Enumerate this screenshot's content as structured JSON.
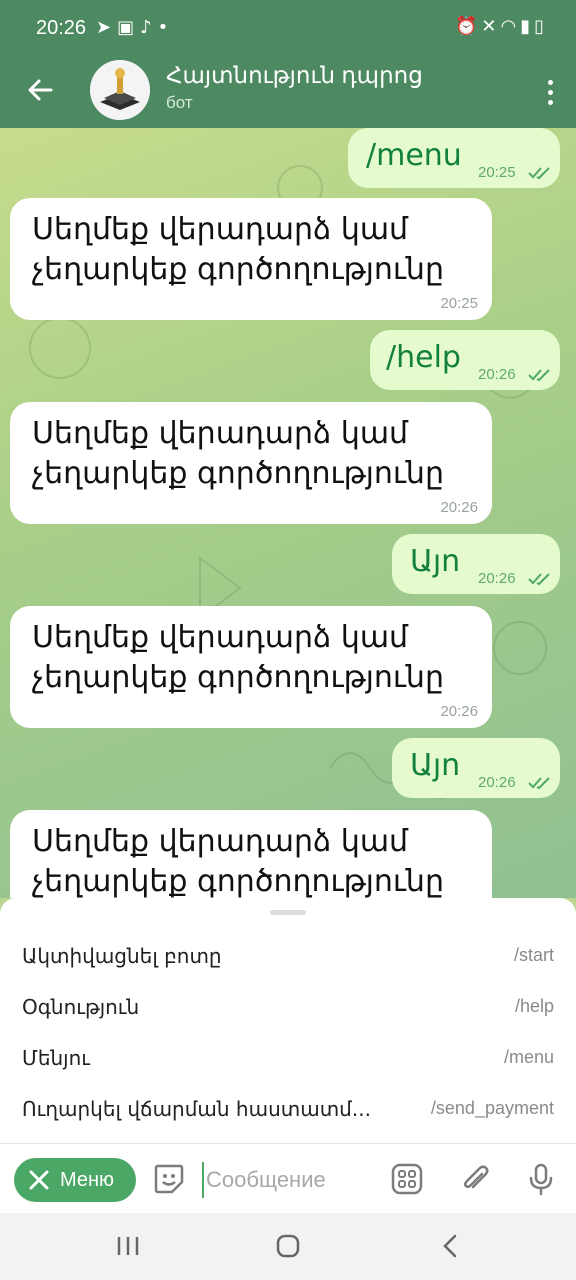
{
  "status_bar": {
    "time": "20:26",
    "left_icons": [
      "telegram-icon",
      "image-icon",
      "notification-icon",
      "dot-icon"
    ],
    "right_icons": [
      "alarm-icon",
      "mute-icon",
      "wifi-icon",
      "signal-icon",
      "battery-icon"
    ]
  },
  "header": {
    "title": "Հայտնություն դպրոց",
    "subtitle": "бот",
    "accent_color": "#4d8a62"
  },
  "messages": [
    {
      "dir": "out",
      "text": "/menu",
      "time": "20:25",
      "read": true
    },
    {
      "dir": "in",
      "text": "Սեղմեք վերադարձ կամ չեղարկեք գործողությունը",
      "time": "20:25"
    },
    {
      "dir": "out",
      "text": "/help",
      "time": "20:26",
      "read": true
    },
    {
      "dir": "in",
      "text": "Սեղմեք վերադարձ կամ չեղարկեք գործողությունը",
      "time": "20:26"
    },
    {
      "dir": "out",
      "text": "Այո",
      "time": "20:26",
      "read": true
    },
    {
      "dir": "in",
      "text": "Սեղմեք վերադարձ կամ չեղարկեք գործողությունը",
      "time": "20:26"
    },
    {
      "dir": "out",
      "text": "Այո",
      "time": "20:26",
      "read": true
    },
    {
      "dir": "in",
      "text": "Սեղմեք վերադարձ կամ չեղարկեք գործողությունը",
      "time": ""
    }
  ],
  "commands": [
    {
      "label": "Ակտիվացնել բոտը",
      "command": "/start"
    },
    {
      "label": "Օգնություն",
      "command": "/help"
    },
    {
      "label": "Մենյու",
      "command": "/menu"
    },
    {
      "label": "Ուղարկել վճարման հաստատմ...",
      "command": "/send_payment"
    }
  ],
  "input": {
    "menu_button_label": "Меню",
    "placeholder": "Сообщение",
    "menu_button_color": "#4aa765"
  }
}
